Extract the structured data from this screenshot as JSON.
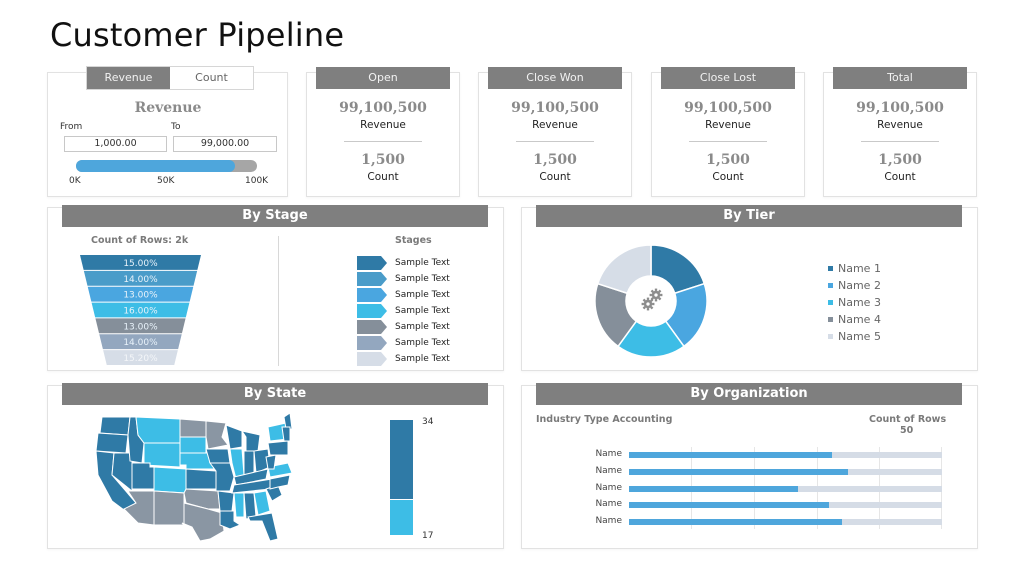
{
  "page": {
    "title": "Customer Pipeline"
  },
  "filter": {
    "toggle": [
      {
        "label": "Revenue",
        "active": true
      },
      {
        "label": "Count",
        "active": false
      }
    ],
    "title": "Revenue",
    "from_label": "From",
    "to_label": "To",
    "from_value": "1,000.00",
    "to_value": "99,000.00",
    "slider": {
      "min_label": "0K",
      "mid_label": "50K",
      "max_label": "100K",
      "fill_fraction": 0.88
    }
  },
  "kpis": [
    {
      "header": "Open",
      "revenue": "99,100,500",
      "revenue_label": "Revenue",
      "count": "1,500",
      "count_label": "Count"
    },
    {
      "header": "Close Won",
      "revenue": "99,100,500",
      "revenue_label": "Revenue",
      "count": "1,500",
      "count_label": "Count"
    },
    {
      "header": "Close Lost",
      "revenue": "99,100,500",
      "revenue_label": "Revenue",
      "count": "1,500",
      "count_label": "Count"
    },
    {
      "header": "Total",
      "revenue": "99,100,500",
      "revenue_label": "Revenue",
      "count": "1,500",
      "count_label": "Count"
    }
  ],
  "by_stage": {
    "title": "By Stage",
    "count_label": "Count of Rows: 2k",
    "stages_label": "Stages",
    "colors": [
      "#2f7aa6",
      "#4a9cc9",
      "#4aa6e0",
      "#3dbde6",
      "#858f9a",
      "#93a7bf",
      "#d6dde7"
    ],
    "stages": [
      "Sample Text",
      "Sample Text",
      "Sample Text",
      "Sample Text",
      "Sample Text",
      "Sample Text",
      "Sample Text"
    ]
  },
  "by_tier": {
    "title": "By Tier",
    "center_icon": "gears-icon",
    "legend": [
      "Name 1",
      "Name 2",
      "Name 3",
      "Name 4",
      "Name 5"
    ]
  },
  "by_state": {
    "title": "By State",
    "scale_max": "34",
    "scale_min": "17",
    "colors": {
      "high": "#2f7aa6",
      "mid": "#3dbde6",
      "low": "#8a96a3"
    }
  },
  "by_org": {
    "title": "By Organization",
    "industry_label": "Industry Type Accounting",
    "count_header": "Count of Rows",
    "count_value": "50"
  },
  "chart_data": [
    {
      "type": "bar",
      "title": "By Stage",
      "subtitle": "Count of Rows: 2k",
      "categories": [
        "Sample Text",
        "Sample Text",
        "Sample Text",
        "Sample Text",
        "Sample Text",
        "Sample Text",
        "Sample Text"
      ],
      "values": [
        15.0,
        14.0,
        13.0,
        16.0,
        13.0,
        14.0,
        15.2
      ],
      "labels": [
        "15.00%",
        "14.00%",
        "13.00%",
        "16.00%",
        "13.00%",
        "14.00%",
        "15.20%"
      ],
      "legend_title": "Stages",
      "legend": "right"
    },
    {
      "type": "pie",
      "title": "By Tier",
      "categories": [
        "Name 1",
        "Name 2",
        "Name 3",
        "Name 4",
        "Name 5"
      ],
      "values": [
        20,
        20,
        20,
        20,
        20
      ],
      "colors": [
        "#2f7aa6",
        "#4aa6e0",
        "#3dbde6",
        "#858f9a",
        "#d6dde7"
      ],
      "legend": "right"
    },
    {
      "type": "heatmap",
      "title": "By State",
      "scale_range": [
        17,
        34
      ]
    },
    {
      "type": "bar",
      "title": "By Organization",
      "subtitle": "Industry Type Accounting",
      "categories": [
        "Name",
        "Name",
        "Name",
        "Name",
        "Name"
      ],
      "values": [
        65,
        70,
        54,
        64,
        68
      ],
      "xlim": [
        0,
        100
      ],
      "grid": true
    }
  ]
}
